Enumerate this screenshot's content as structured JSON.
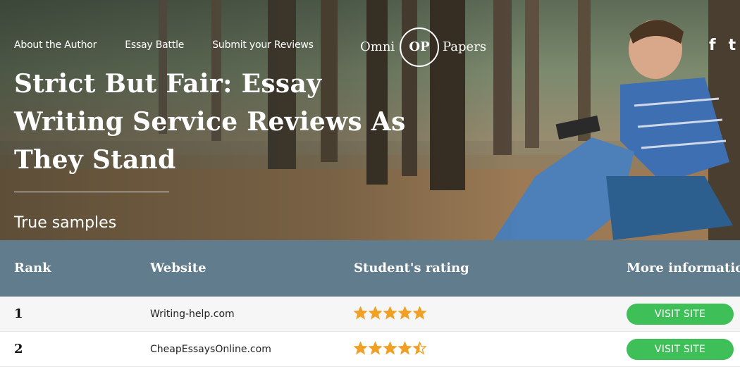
{
  "nav": {
    "items": [
      "About the Author",
      "Essay Battle",
      "Submit your Reviews"
    ]
  },
  "logo": {
    "word_left": "Omni",
    "monogram": "OP",
    "word_right": "Papers"
  },
  "social": {
    "icons": [
      "facebook-icon",
      "twitter-icon"
    ],
    "facebook_glyph": "f",
    "twitter_glyph": "t"
  },
  "hero": {
    "title": "Strict But Fair: Essay Writing Service Reviews As They Stand",
    "subtitle": "True samples"
  },
  "table": {
    "headers": [
      "Rank",
      "Website",
      "Student's rating",
      "More information"
    ],
    "rows": [
      {
        "rank": "1",
        "website": "Writing-help.com",
        "rating": 5,
        "button": "Visit site"
      },
      {
        "rank": "2",
        "website": "CheapEssaysOnline.com",
        "rating": 4.5,
        "button": "Visit site"
      }
    ]
  },
  "colors": {
    "header_bg": "#617c8c",
    "button_green": "#3fbf58",
    "star_gold": "#f0a024"
  }
}
